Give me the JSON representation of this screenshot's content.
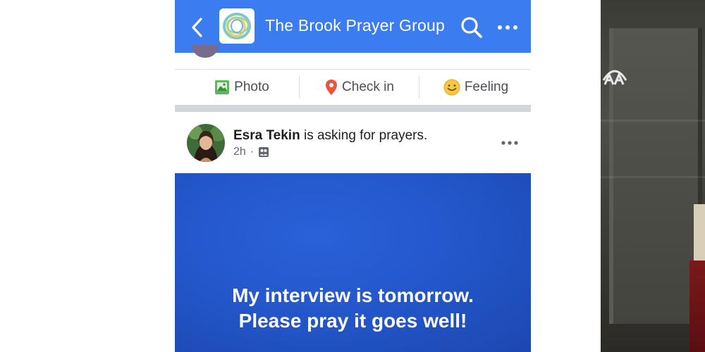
{
  "header": {
    "title": "The Brook Prayer Group",
    "back_icon": "chevron-left-icon",
    "search_icon": "search-icon",
    "more_icon": "more-horizontal-icon",
    "bar_color": "#3b7cf0"
  },
  "composer_actions": [
    {
      "label": "Photo",
      "icon": "photo-icon"
    },
    {
      "label": "Check in",
      "icon": "location-pin-icon"
    },
    {
      "label": "Feeling",
      "icon": "smiley-icon"
    }
  ],
  "post": {
    "author": "Esra Tekin",
    "action_text": " is asking for prayers.",
    "time": "2h",
    "separator": "·",
    "audience_icon": "group-audience-icon",
    "message_line1": "My interview is tomorrow.",
    "message_line2": "Please pray it goes well!",
    "background_color": "#2356c9"
  },
  "watermark": {
    "icon": "aa-logo"
  }
}
